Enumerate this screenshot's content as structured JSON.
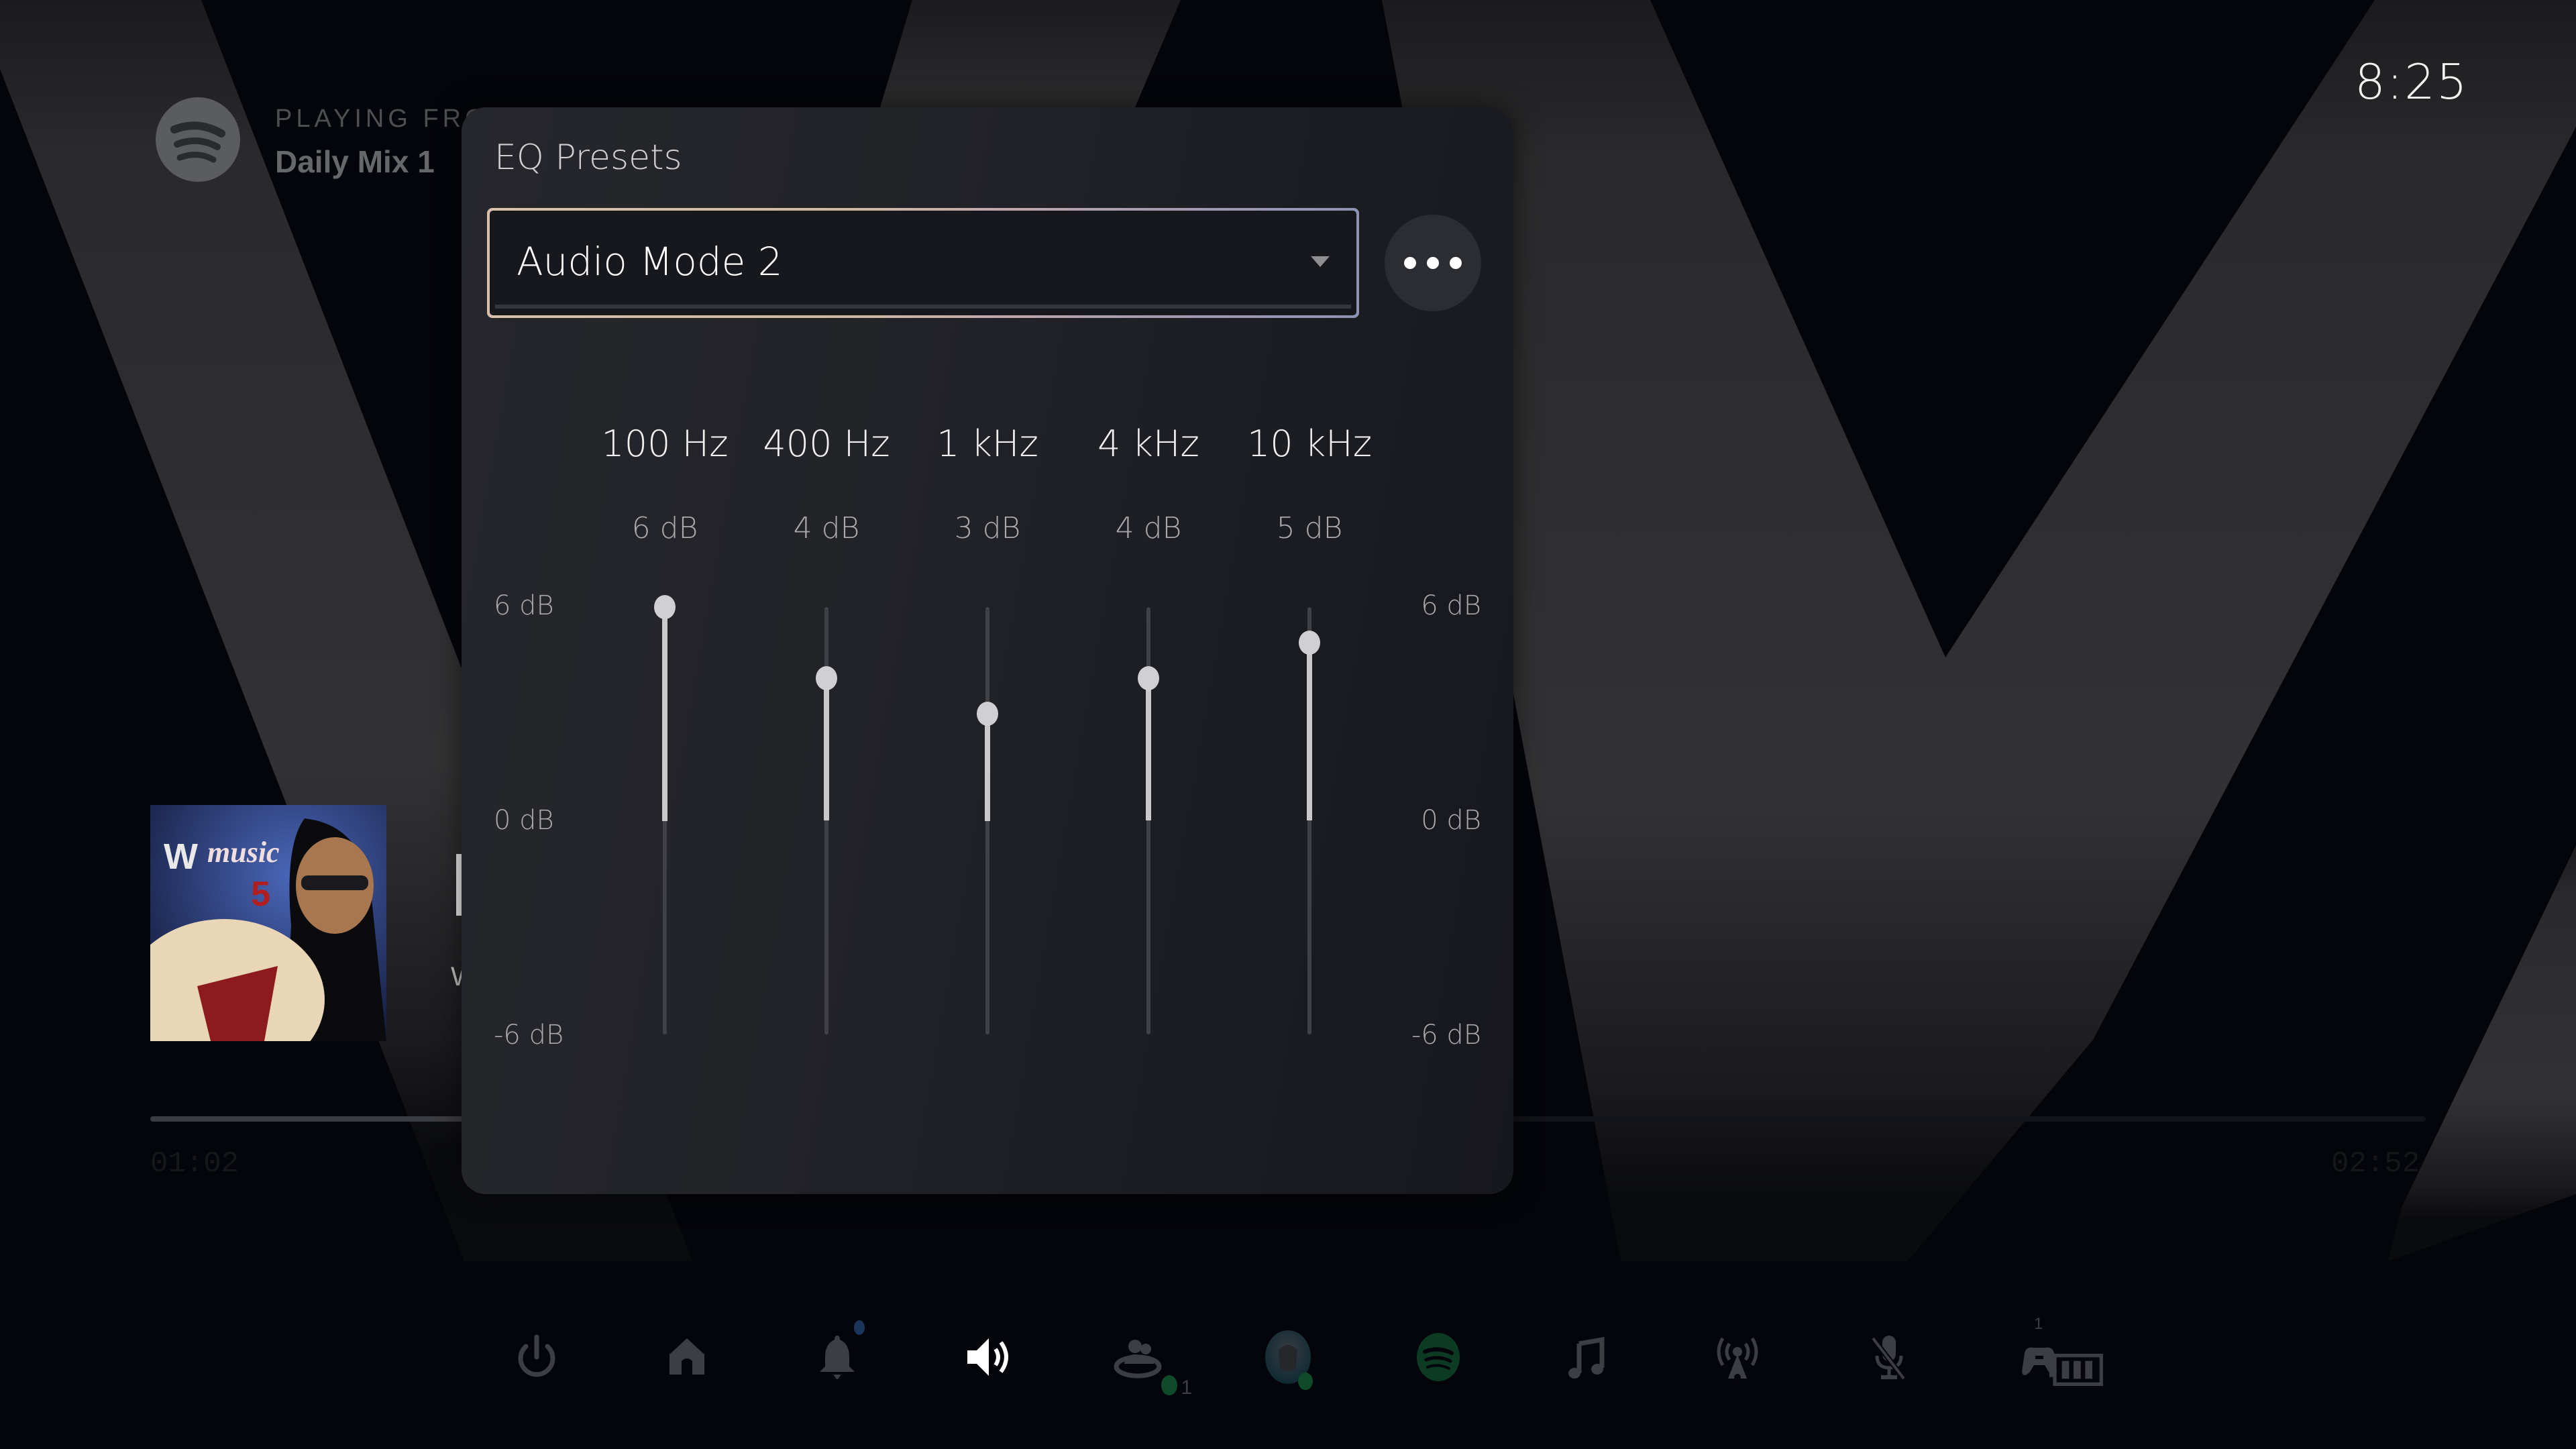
{
  "header": {
    "source_icon": "spotify-icon",
    "playing_from_label": "PLAYING FRO",
    "playlist_name": "Daily Mix 1",
    "clock": "8:25"
  },
  "now_playing": {
    "album_art": "album-cover-wwf-the-music-vol-5",
    "album_art_text": "WWF The Music Vol. 5",
    "elapsed": "01:02",
    "duration": "02:52",
    "progress_fraction": 0.36
  },
  "eq_panel": {
    "title": "EQ Presets",
    "preset": {
      "selected": "Audio Mode 2",
      "caret_icon": "caret-down-icon"
    },
    "more_button_icon": "more-options-icon",
    "range": {
      "min_db": -6,
      "max_db": 6
    },
    "axis_labels": {
      "top": "6 dB",
      "middle": "0 dB",
      "bottom": "-6 dB"
    },
    "bands": [
      {
        "frequency": "100 Hz",
        "gain_label": "6 dB",
        "gain_db": 6
      },
      {
        "frequency": "400 Hz",
        "gain_label": "4 dB",
        "gain_db": 4
      },
      {
        "frequency": "1 kHz",
        "gain_label": "3 dB",
        "gain_db": 3
      },
      {
        "frequency": "4 kHz",
        "gain_label": "4 dB",
        "gain_db": 4
      },
      {
        "frequency": "10 kHz",
        "gain_label": "5 dB",
        "gain_db": 5
      }
    ]
  },
  "control_center": {
    "items": [
      {
        "name": "power",
        "icon": "power-icon",
        "active": false
      },
      {
        "name": "home",
        "icon": "home-icon",
        "active": false
      },
      {
        "name": "notifications",
        "icon": "bell-icon",
        "active": false,
        "has_dot": true
      },
      {
        "name": "sound",
        "icon": "speaker-icon",
        "active": true
      },
      {
        "name": "game-base",
        "icon": "friends-icon",
        "active": false,
        "count": "1"
      },
      {
        "name": "profile",
        "icon": "avatar-icon",
        "active": false,
        "online": true
      },
      {
        "name": "spotify",
        "icon": "spotify-icon",
        "active": false
      },
      {
        "name": "music",
        "icon": "music-note-icon",
        "active": false
      },
      {
        "name": "broadcast",
        "icon": "broadcast-icon",
        "active": false
      },
      {
        "name": "mic",
        "icon": "mic-muted-icon",
        "active": false
      },
      {
        "name": "accessories",
        "icon": "controller-icon",
        "active": false,
        "count": "1",
        "battery_icon": "battery-icon"
      }
    ]
  },
  "colors": {
    "online_green": "#0f4a2a",
    "spotify_green": "#0d3a22",
    "notification_blue": "#1c355a",
    "icon_inactive": "#3d3e43",
    "icon_active": "#ffffff"
  }
}
